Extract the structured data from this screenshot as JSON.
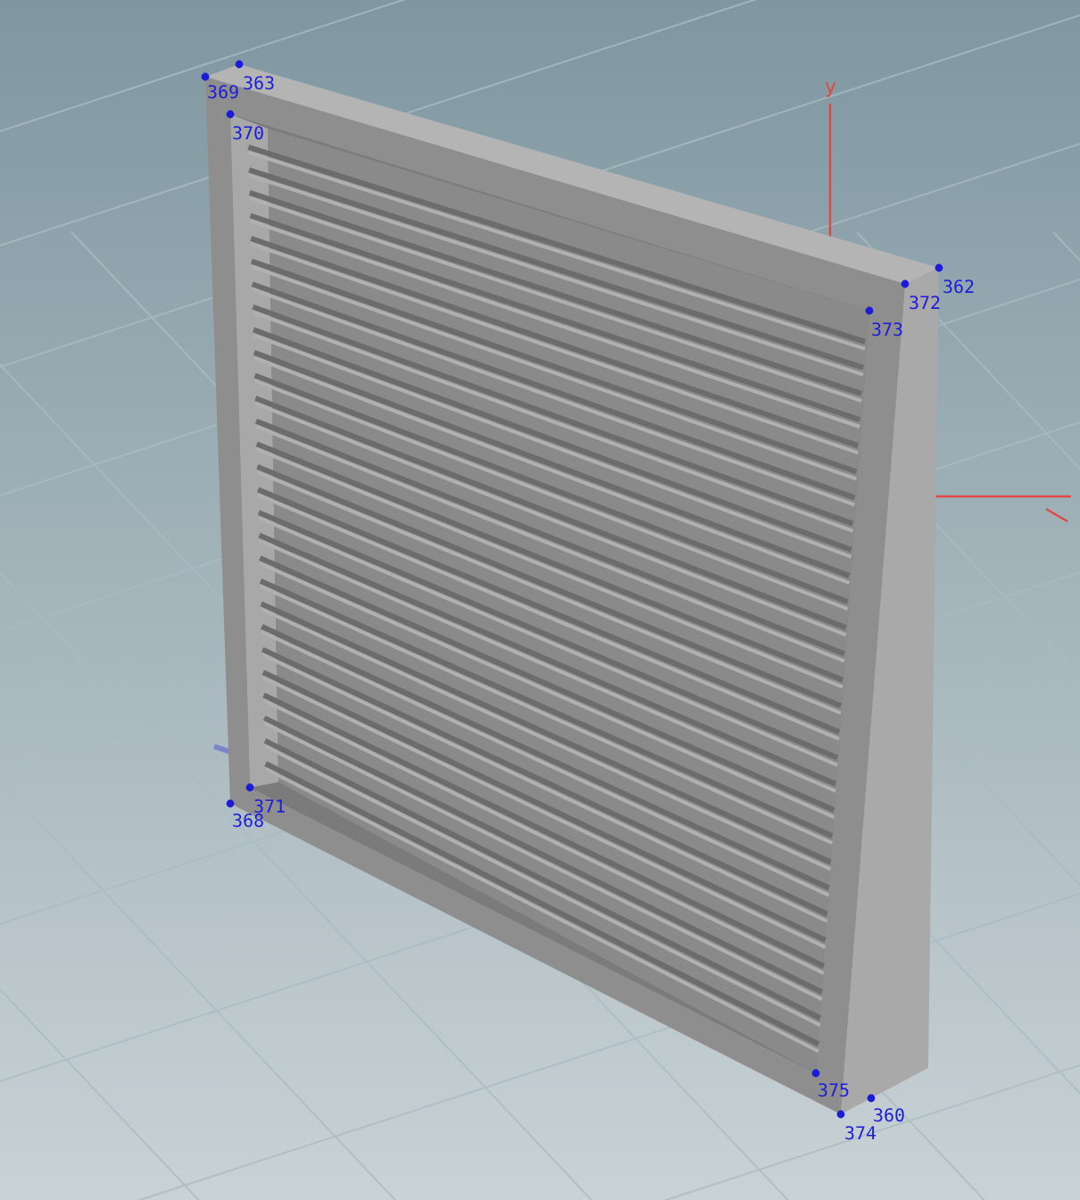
{
  "viewport": {
    "axis_label": "y",
    "points": [
      {
        "label": "363"
      },
      {
        "label": "369"
      },
      {
        "label": "370"
      },
      {
        "label": "362"
      },
      {
        "label": "372"
      },
      {
        "label": "373"
      },
      {
        "label": "371"
      },
      {
        "label": "368"
      },
      {
        "label": "375"
      },
      {
        "label": "360"
      },
      {
        "label": "374"
      }
    ]
  }
}
